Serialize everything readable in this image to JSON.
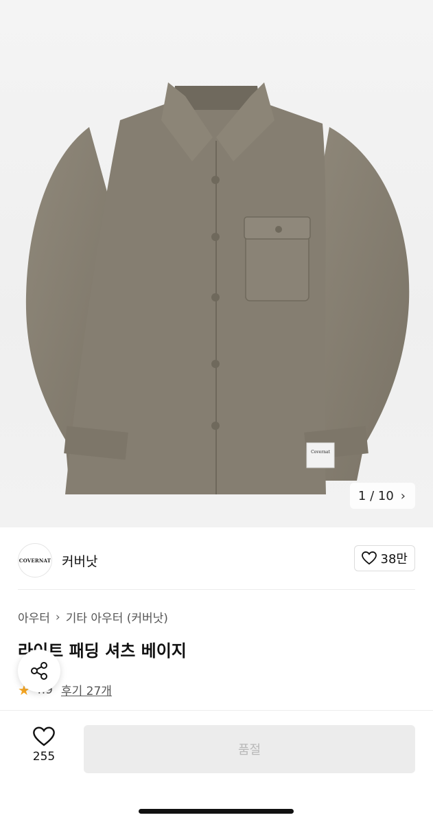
{
  "gallery": {
    "pager_current": "1",
    "pager_separator": "/",
    "pager_total": "10",
    "tag_text": "Covernat"
  },
  "brand": {
    "logo_text": "COVERNAT",
    "name": "커버낫",
    "like_count": "38만"
  },
  "breadcrumb": {
    "level1": "아우터",
    "level2": "기타 아우터 (커버낫)"
  },
  "product": {
    "title": "라이트 패딩 셔츠 베이지",
    "rating": "4.9",
    "reviews_label": "후기 27개"
  },
  "bottom_bar": {
    "wish_count": "255",
    "cta_label": "품절"
  },
  "colors": {
    "jacket": "#867f72",
    "accent_star": "#f5a623",
    "disabled_bg": "#ececec",
    "disabled_text": "#b8b8b8"
  }
}
